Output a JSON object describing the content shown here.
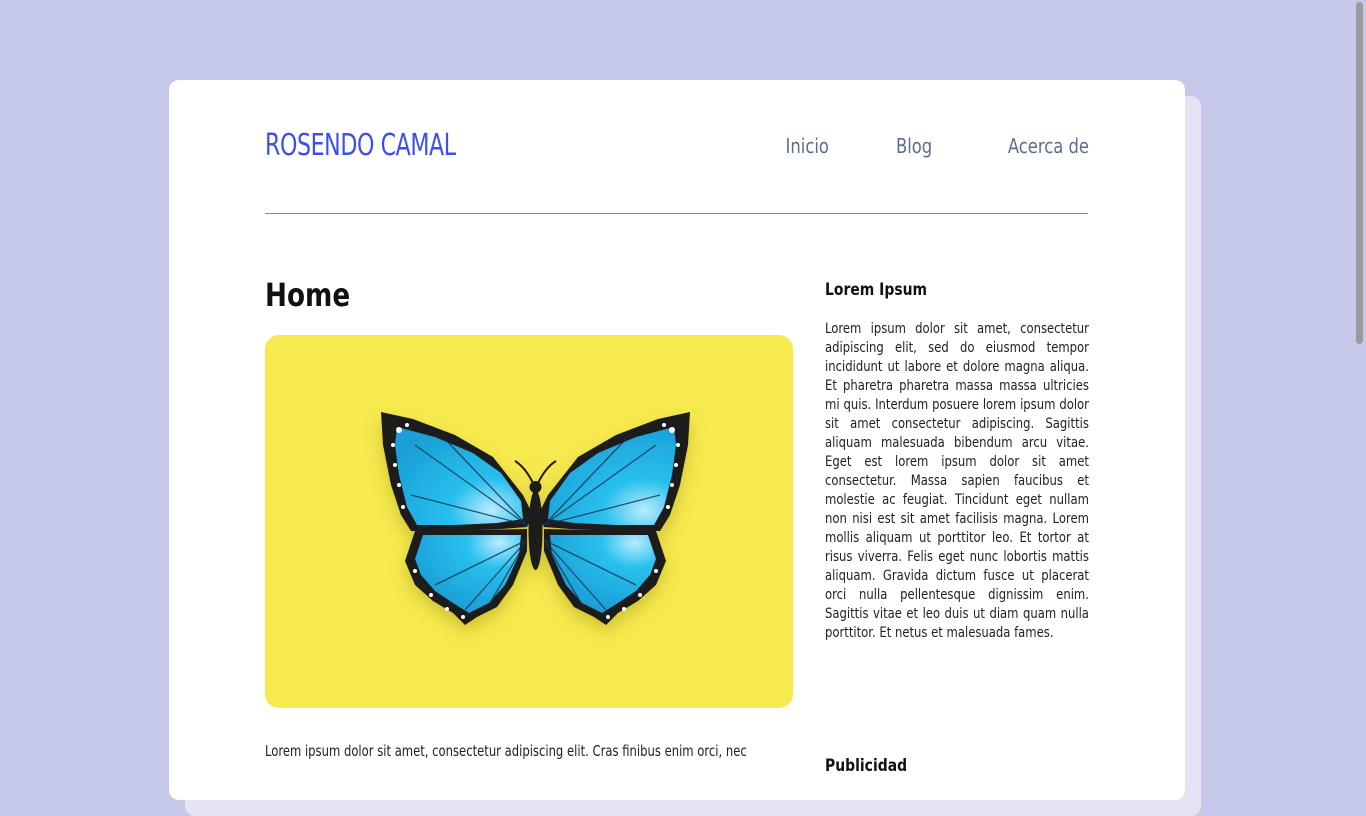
{
  "header": {
    "brand": "ROSENDO CAMAL",
    "nav": [
      "Inicio",
      "Blog",
      "Acerca de"
    ]
  },
  "main": {
    "title": "Home",
    "hero_image": "butterfly-illustration",
    "paragraph": "Lorem ipsum dolor sit amet, consectetur adipiscing elit. Cras finibus enim orci, nec"
  },
  "sidebar": {
    "title": "Lorem Ipsum",
    "text": "Lorem ipsum dolor sit amet, consectetur adipiscing elit, sed do eiusmod tempor incididunt ut labore et dolore magna aliqua. Et pharetra pharetra massa massa ultricies mi quis. Interdum posuere lorem ipsum dolor sit amet consectetur adipiscing. Sagittis aliquam malesuada bibendum arcu vitae. Eget est lorem ipsum dolor sit amet consectetur. Massa sapien faucibus et molestie ac feugiat. Tincidunt eget nullam non nisi est sit amet facilisis magna. Lorem mollis aliquam ut porttitor leo. Et tortor at risus viverra. Felis eget nunc lobortis mattis aliquam. Gravida dictum fusce ut placerat orci nulla pellentesque dignissim enim. Sagittis vitae et leo duis ut diam quam nulla porttitor. Et netus et malesuada fames.",
    "title_2": "Publicidad"
  },
  "colors": {
    "page_bg": "#c5c8e8",
    "brand": "#3b4ef0",
    "nav": "#5b6f8a",
    "hero_bg": "#f6ea4e",
    "wing": "#1fb8e8"
  }
}
